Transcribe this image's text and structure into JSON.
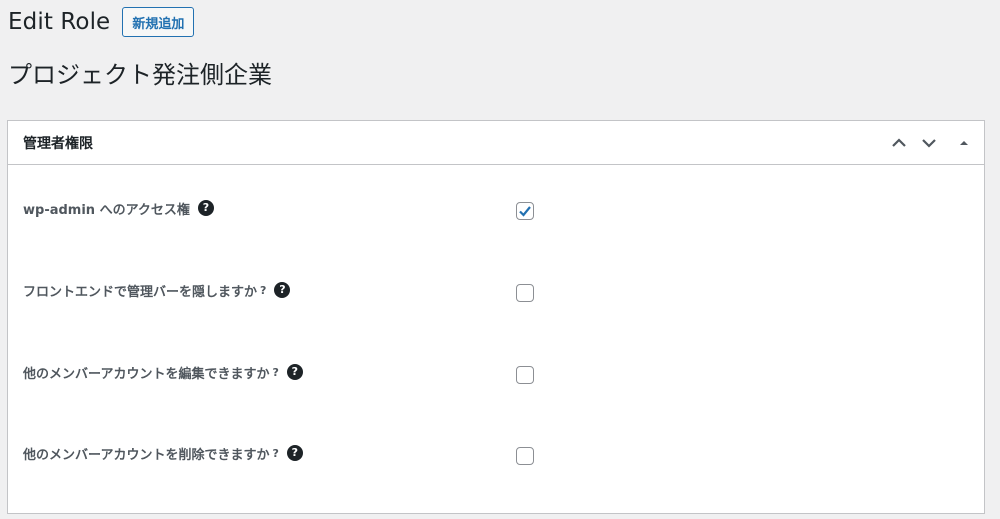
{
  "header": {
    "title": "Edit Role",
    "add_new_label": "新規追加"
  },
  "role": {
    "name": "プロジェクト発注側企業"
  },
  "postbox": {
    "title": "管理者権限",
    "fields": [
      {
        "label": "wp-admin へのアクセス権",
        "suffix": "",
        "checked": true
      },
      {
        "label": "フロントエンドで管理バーを隠しますか",
        "suffix": "?",
        "checked": false
      },
      {
        "label": "他のメンバーアカウントを編集できますか",
        "suffix": "?",
        "checked": false
      },
      {
        "label": "他のメンバーアカウントを削除できますか",
        "suffix": "?",
        "checked": false
      }
    ]
  },
  "icons": {
    "help": "question-circle-icon",
    "move_up": "chevron-up-icon",
    "move_down": "chevron-down-icon",
    "toggle": "triangle-up-icon",
    "check": "checkmark-icon"
  },
  "colors": {
    "accent": "#2271b1",
    "check": "#2271b1",
    "background": "#f0f0f1"
  }
}
